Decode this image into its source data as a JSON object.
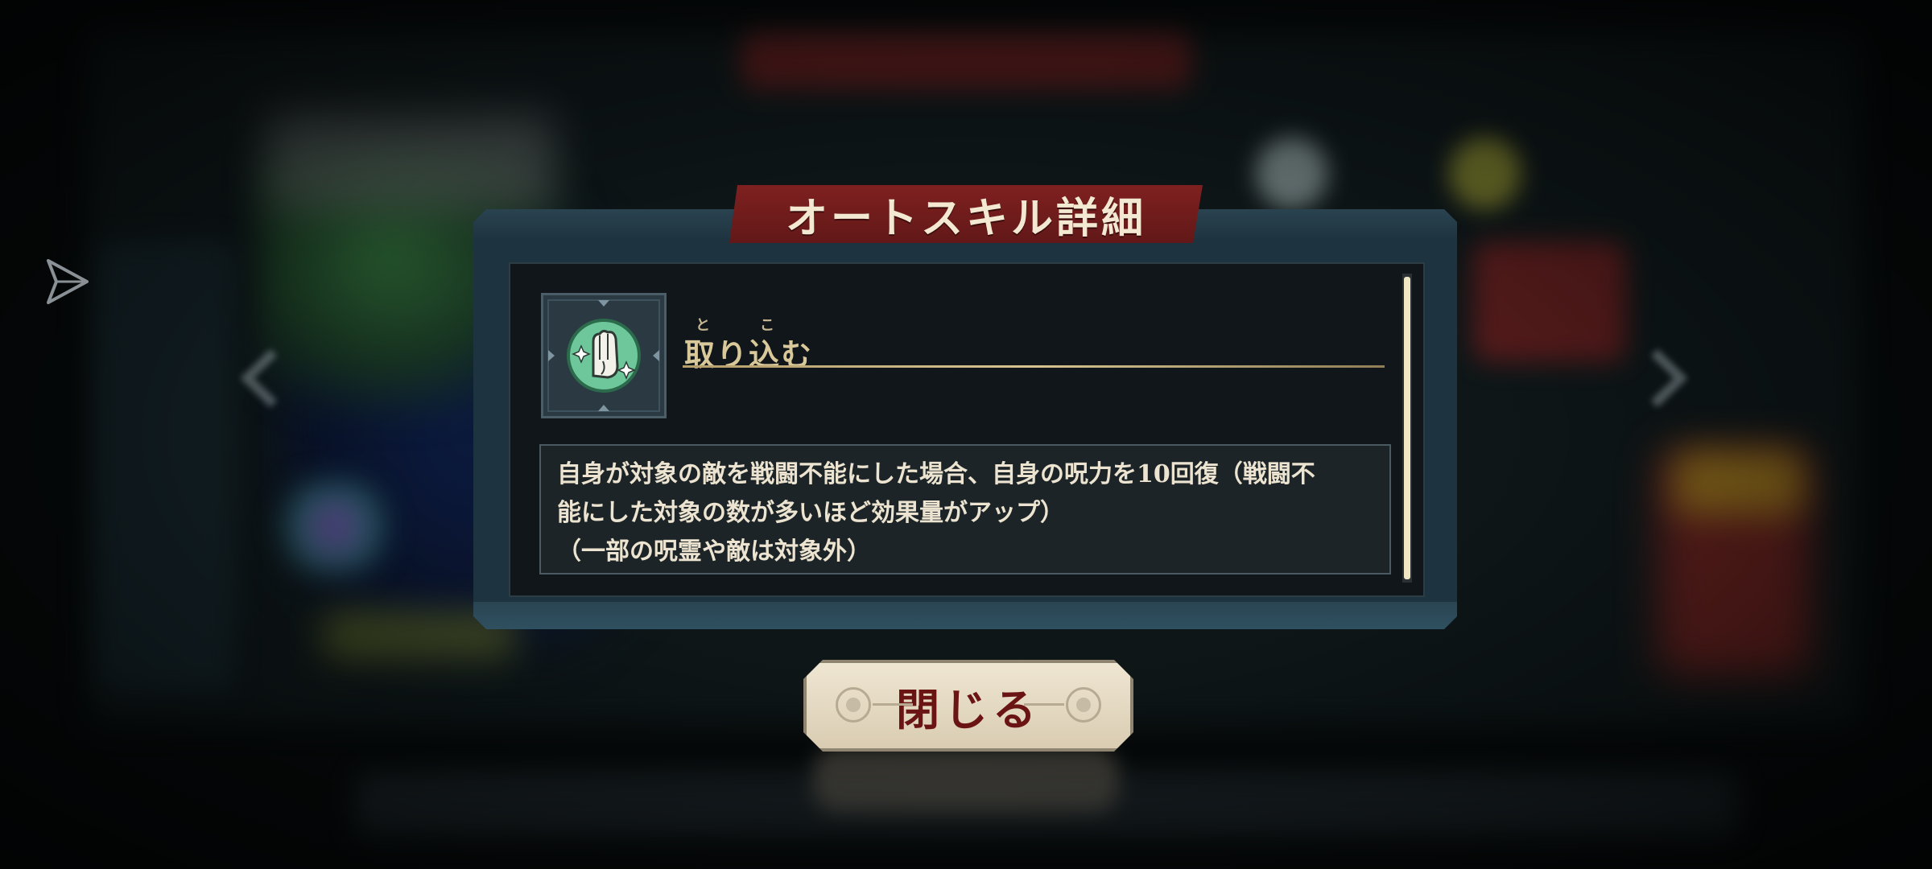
{
  "dialog": {
    "title": "オートスキル詳細",
    "skill": {
      "name": "取り込む",
      "ruby": [
        "と",
        "こ"
      ],
      "icon": "grasping-hand-icon",
      "description": [
        "自身が対象の敵を戦闘不能にした場合、自身の呪力を10回復（戦闘不",
        "能にした対象の数が多いほど効果量がアップ）",
        "（一部の呪霊や敵は対象外）"
      ]
    },
    "close_label": "閉じる"
  },
  "colors": {
    "title_plate": "#7f2020",
    "frame": "#1d3340",
    "close_text": "#6a1414",
    "icon_green": "#6ec79a"
  }
}
